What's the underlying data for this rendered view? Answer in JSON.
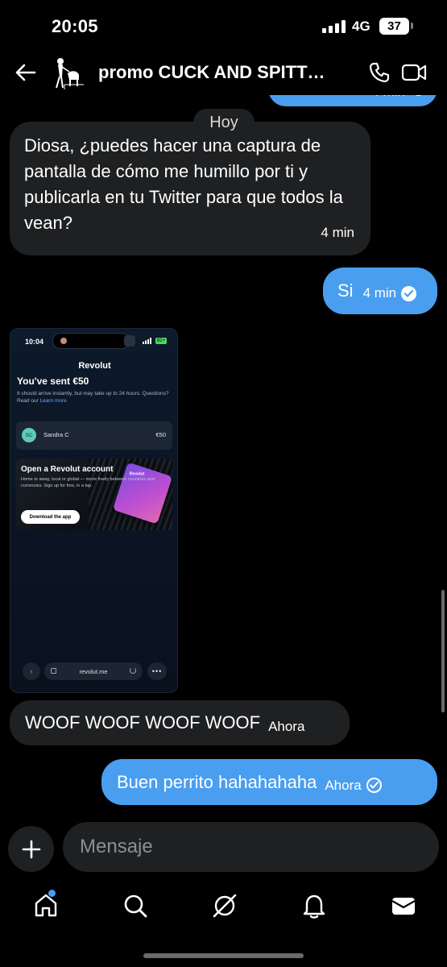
{
  "status_bar": {
    "time": "20:05",
    "network": "4G",
    "battery": "37"
  },
  "header": {
    "title": "promo CUCK AND SPITT…"
  },
  "chat": {
    "day_separator": "Hoy",
    "previous_outgoing_time": "4 min",
    "messages": [
      {
        "direction": "incoming",
        "text": "Diosa, ¿puedes hacer una captura de pantalla de cómo me humillo por ti y publicarla en tu Twitter para que todos la vean?",
        "time": "4 min"
      },
      {
        "direction": "outgoing",
        "text": "Si",
        "time": "4 min",
        "status": "read"
      },
      {
        "direction": "incoming",
        "type": "image",
        "image": {
          "time": "10:04",
          "brand": "Revolut",
          "headline": "You've sent €50",
          "info": "It should arrive instantly, but may take up to 24 hours. Questions? Read our",
          "learn_more": "Learn more",
          "recipient_initials": "SC",
          "recipient_name": "Sandra C",
          "amount": "€50",
          "promo_title": "Open a Revolut account",
          "promo_desc": "Home or away, local or global — move freely between countries and currencies. Sign up for free, in a tap.",
          "promo_button": "Download the app",
          "card_brand": "Revolut",
          "url": "revolut.me",
          "battery": "82+"
        }
      },
      {
        "direction": "incoming",
        "text": "WOOF WOOF WOOF WOOF",
        "time": "Ahora"
      },
      {
        "direction": "outgoing",
        "text": "Buen perrito hahahahaha",
        "time": "Ahora",
        "status": "sent"
      }
    ]
  },
  "composer": {
    "placeholder": "Mensaje"
  },
  "tabbar": {
    "items": [
      "home-icon",
      "search-icon",
      "grok-icon",
      "notifications-icon",
      "messages-icon"
    ]
  },
  "colors": {
    "background": "#000000",
    "incoming_bubble": "#1f2022",
    "outgoing_bubble": "#4a9ef0",
    "accent": "#4a9ef0"
  }
}
